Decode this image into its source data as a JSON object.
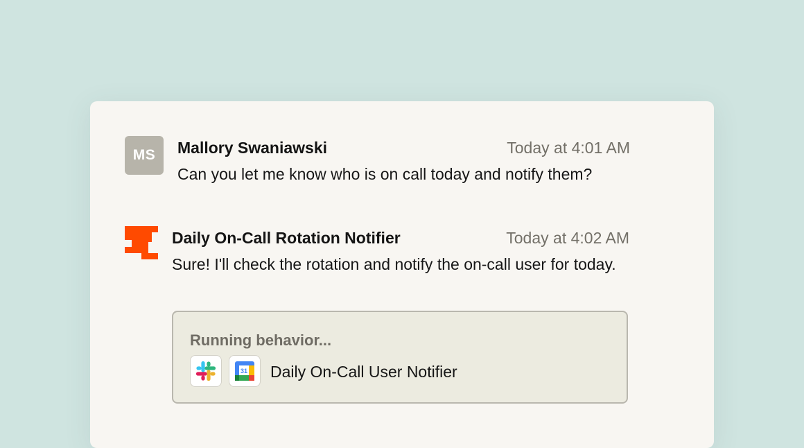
{
  "messages": [
    {
      "avatar_initials": "MS",
      "sender": "Mallory Swaniawski",
      "timestamp": "Today at 4:01 AM",
      "text": "Can you let me know who is on call today and notify them?"
    },
    {
      "avatar_icon": "bot-logo-icon",
      "sender": "Daily On-Call Rotation Notifier",
      "timestamp": "Today at 4:02 AM",
      "text": "Sure! I'll check the rotation and notify the on-call user for today."
    }
  ],
  "behavior": {
    "status": "Running behavior...",
    "apps": [
      {
        "icon": "slack-icon"
      },
      {
        "icon": "google-calendar-icon",
        "label": "31"
      }
    ],
    "name": "Daily On-Call User Notifier"
  },
  "colors": {
    "background": "#cfe4e0",
    "card": "#f8f6f2",
    "avatar": "#b7b4aa",
    "bot_logo": "#ff4a00",
    "behavior_panel": "#ecebe0",
    "muted_text": "#737068"
  }
}
